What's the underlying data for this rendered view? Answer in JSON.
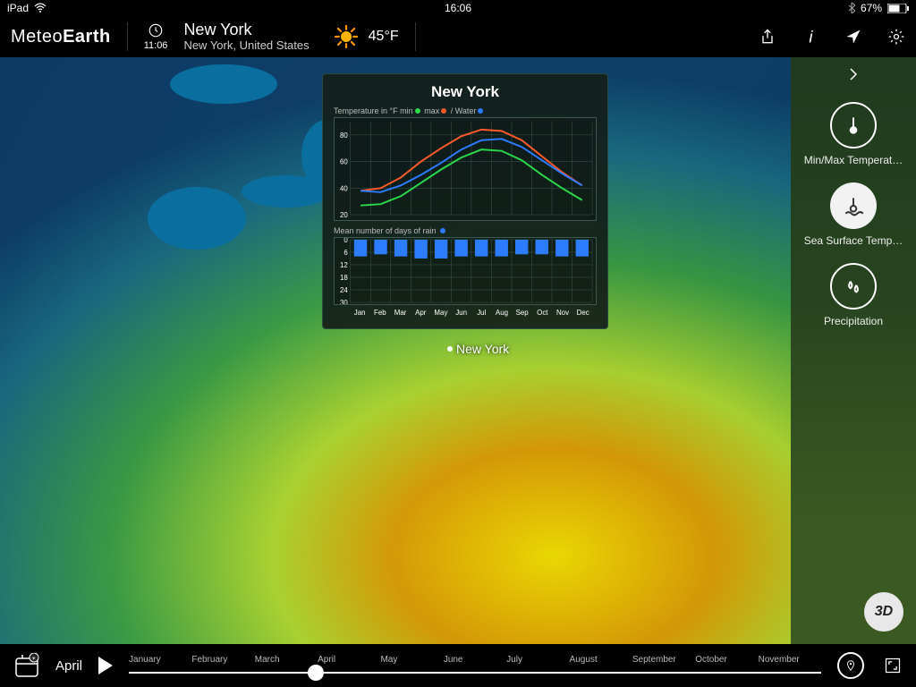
{
  "status": {
    "device": "iPad",
    "time": "16:06",
    "battery": "67%"
  },
  "app_name": {
    "a": "Meteo",
    "b": "Earth"
  },
  "gmt_clock": "11:06",
  "location": {
    "city": "New York",
    "region": "New York, United States"
  },
  "current": {
    "temp": "45°F"
  },
  "map_city_label": "New York",
  "popup": {
    "title": "New York",
    "temp_legend_prefix": "Temperature in °F",
    "legend_min": "min",
    "legend_max": "max",
    "legend_water": "/ Water",
    "rain_legend": "Mean number of days of rain"
  },
  "layers": {
    "minmax": "Min/Max Temperat…",
    "sst": "Sea Surface Temp…",
    "precip": "Precipitation"
  },
  "btn3d": "3D",
  "footer": {
    "current_month": "April",
    "thumb_percent": 27
  },
  "months_short": [
    "Jan",
    "Feb",
    "Mar",
    "Apr",
    "May",
    "Jun",
    "Jul",
    "Aug",
    "Sep",
    "Oct",
    "Nov",
    "Dec"
  ],
  "months_long": [
    "January",
    "February",
    "March",
    "April",
    "May",
    "June",
    "July",
    "August",
    "September",
    "October",
    "November"
  ],
  "chart_data": [
    {
      "type": "line",
      "title": "Temperature in °F — New York",
      "xlabel": "",
      "ylabel": "°F",
      "ylim": [
        20,
        90
      ],
      "categories": [
        "Jan",
        "Feb",
        "Mar",
        "Apr",
        "May",
        "Jun",
        "Jul",
        "Aug",
        "Sep",
        "Oct",
        "Nov",
        "Dec"
      ],
      "yticks": [
        20,
        40,
        60,
        80
      ],
      "series": [
        {
          "name": "max",
          "color": "#ff5a2c",
          "values": [
            38,
            40,
            48,
            60,
            70,
            79,
            84,
            83,
            76,
            64,
            52,
            42
          ]
        },
        {
          "name": "Water",
          "color": "#2d7bff",
          "values": [
            38,
            37,
            42,
            50,
            59,
            69,
            76,
            77,
            71,
            61,
            51,
            42
          ]
        },
        {
          "name": "min",
          "color": "#2bd94a",
          "values": [
            27,
            28,
            34,
            44,
            54,
            63,
            69,
            68,
            61,
            50,
            40,
            31
          ]
        }
      ]
    },
    {
      "type": "bar",
      "title": "Mean number of days of rain — New York",
      "xlabel": "",
      "ylabel": "days",
      "ylim": [
        0,
        30
      ],
      "inverted": true,
      "categories": [
        "Jan",
        "Feb",
        "Mar",
        "Apr",
        "May",
        "Jun",
        "Jul",
        "Aug",
        "Sep",
        "Oct",
        "Nov",
        "Dec"
      ],
      "yticks": [
        0,
        6,
        12,
        18,
        24,
        30
      ],
      "values": [
        8,
        7,
        8,
        9,
        9,
        8,
        8,
        8,
        7,
        7,
        8,
        8
      ],
      "color": "#2d7bff"
    }
  ]
}
